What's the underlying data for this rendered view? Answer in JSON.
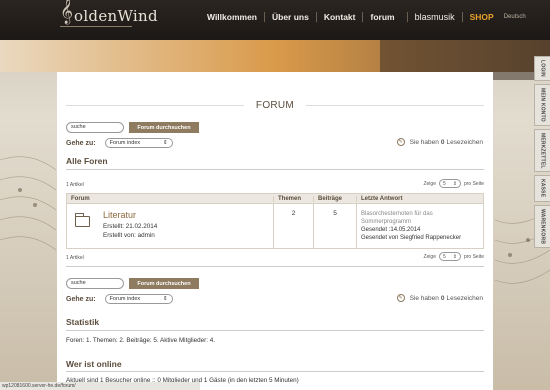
{
  "header": {
    "logo_clef": "𝄞",
    "logo_text": "oldenWind",
    "nav": [
      {
        "label": "Willkommen"
      },
      {
        "label": "Über uns"
      },
      {
        "label": "Kontakt"
      },
      {
        "label": "forum"
      },
      {
        "label": "blasmusik"
      },
      {
        "label": "SHOP"
      }
    ],
    "language": "Deutsch"
  },
  "sidebar_tabs": [
    "LOGIN",
    "MEIN KONTO",
    "MERKZETTEL",
    "KASSE",
    "WARENKORB"
  ],
  "page": {
    "title": "FORUM",
    "search": {
      "placeholder": "suche",
      "value": "suche",
      "button": "Forum durchsuchen"
    },
    "jump": {
      "label": "Gehe zu:",
      "selected": "Forum index"
    },
    "bookmarks": {
      "prefix": "Sie haben",
      "count": "0",
      "suffix": "Lesezeichen"
    },
    "all_forums_heading": "Alle Foren",
    "articles_count": "1 Artikel",
    "zeige": {
      "label": "Zeige",
      "value": "5",
      "suffix": "pro Seite"
    },
    "table": {
      "headers": [
        "Forum",
        "Themen",
        "Beiträge",
        "Letzte Antwort"
      ],
      "rows": [
        {
          "name": "Literatur",
          "created": "Erstellt: 21.02.2014",
          "created_by": "Erstellt von: admin",
          "topics": "2",
          "posts": "5",
          "last_title": "Blasorchesternoten für das Sommerprogramm",
          "last_sent": "Gesendet :14.05.2014",
          "last_by": "Gesendet von Siegfried Rappenecker"
        }
      ]
    },
    "stats_heading": "Statistik",
    "stats_text": "Foren: 1.  Themen: 2.  Beiträge: 5.  Aktive Mitglieder: 4.",
    "online_heading": "Wer ist online",
    "online_text": "Aktuell sind 1 Besucher online :: 0 Mitglieder und 1 Gäste (in den letzten 5 Minuten)"
  },
  "status_bar": "wp12081600.server-he.de/forum/"
}
